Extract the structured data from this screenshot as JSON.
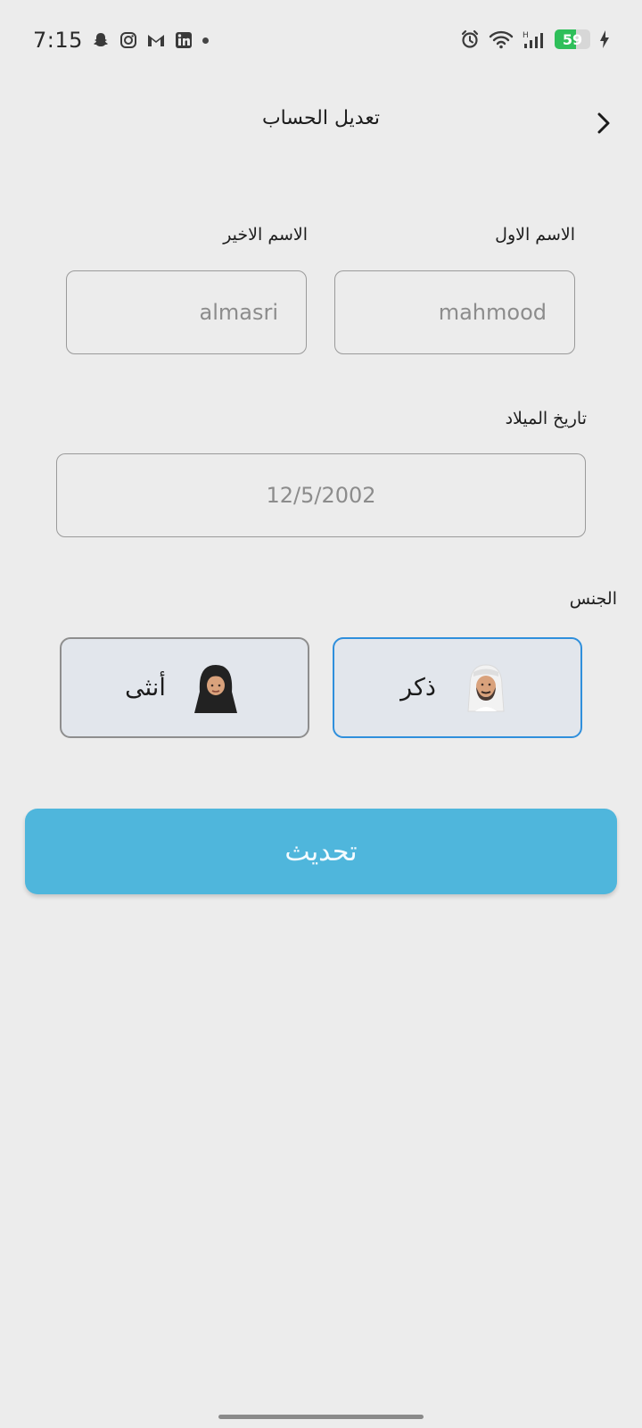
{
  "status_bar": {
    "time": "7:15",
    "battery": 59,
    "icons": [
      "snapchat-icon",
      "instagram-icon",
      "gmail-icon",
      "linkedin-icon",
      "alarm-icon",
      "wifi-icon",
      "signal-icon",
      "charging-icon"
    ]
  },
  "header": {
    "title": "تعديل الحساب",
    "back_icon": "chevron-right-icon"
  },
  "form": {
    "first_name": {
      "label": "الاسم الاول",
      "value": "mahmood"
    },
    "last_name": {
      "label": "الاسم الاخير",
      "value": "almasri"
    },
    "birth_date": {
      "label": "تاريخ الميلاد",
      "value": "12/5/2002"
    },
    "gender": {
      "label": "الجنس",
      "selected": "male",
      "options": [
        {
          "id": "male",
          "label": "ذكر",
          "icon": "man-avatar-icon"
        },
        {
          "id": "female",
          "label": "أنثى",
          "icon": "woman-avatar-icon"
        }
      ]
    }
  },
  "submit": {
    "label": "تحديث"
  },
  "colors": {
    "background": "#ececec",
    "accent": "#4fb6dc",
    "selected_border": "#2f8fdc",
    "battery": "#2fbf5a"
  }
}
